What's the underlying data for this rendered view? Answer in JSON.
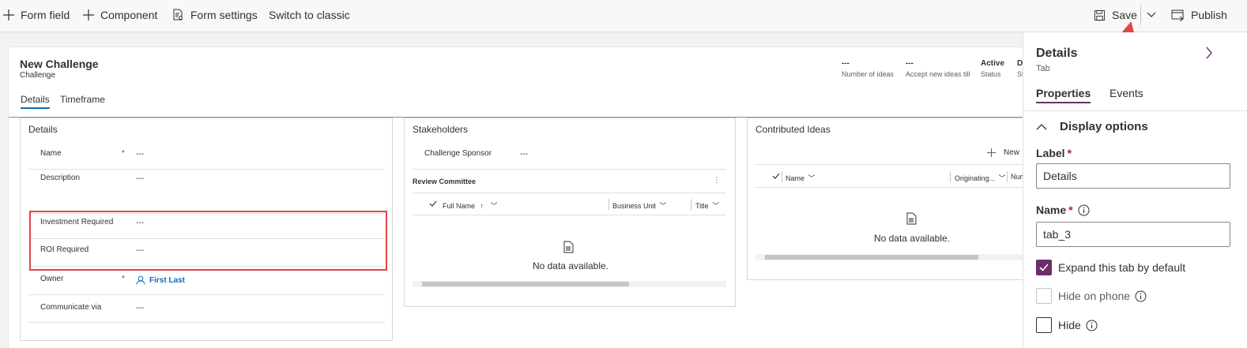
{
  "toolbar": {
    "form_field": "Form field",
    "component": "Component",
    "form_settings": "Form settings",
    "switch_classic": "Switch to classic",
    "save": "Save",
    "publish": "Publish"
  },
  "header": {
    "title": "New Challenge",
    "subtitle": "Challenge",
    "fields": [
      {
        "value": "---",
        "label": "Number of ideas"
      },
      {
        "value": "---",
        "label": "Accept new ideas till"
      },
      {
        "value": "Active",
        "label": "Status"
      },
      {
        "value": "D",
        "label": "St"
      }
    ]
  },
  "tabs": [
    {
      "label": "Details",
      "active": true
    },
    {
      "label": "Timeframe",
      "active": false
    }
  ],
  "details_section": {
    "title": "Details",
    "fields": [
      {
        "label": "Name",
        "required": "*",
        "value": "---"
      },
      {
        "label": "Description",
        "required": "",
        "value": "---"
      },
      {
        "label": "Investment Required",
        "required": "",
        "value": "---"
      },
      {
        "label": "ROI Required",
        "required": "",
        "value": "---"
      },
      {
        "label": "Owner",
        "required": "*",
        "value": "First Last"
      },
      {
        "label": "Communicate via",
        "required": "",
        "value": "---"
      }
    ]
  },
  "stakeholders_section": {
    "title": "Stakeholders",
    "sponsor_label": "Challenge Sponsor",
    "sponsor_value": "---",
    "subgrid_title": "Review Committee",
    "columns": [
      "Full Name",
      "Business Unit",
      "Title"
    ],
    "empty": "No data available."
  },
  "ideas_section": {
    "title": "Contributed Ideas",
    "new_label": "New",
    "columns": [
      "Name",
      "Originating...",
      "Num"
    ],
    "empty": "No data available."
  },
  "panel": {
    "title": "Details",
    "subtitle": "Tab",
    "tabs": [
      "Properties",
      "Events"
    ],
    "section": "Display options",
    "label_label": "Label",
    "label_value": "Details",
    "name_label": "Name",
    "name_value": "tab_3",
    "expand": "Expand this tab by default",
    "hide_phone": "Hide on phone",
    "hide": "Hide",
    "required_mark": "*"
  },
  "colors": {
    "accent": "#6b2e6b",
    "highlight": "#e04646",
    "link": "#0f6cbd"
  }
}
